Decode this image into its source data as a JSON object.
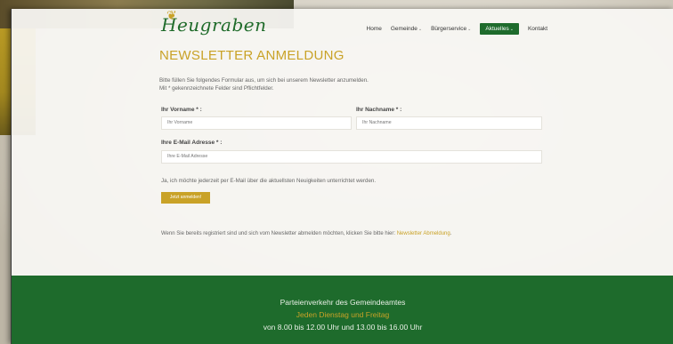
{
  "header": {
    "logo_text": "Heugraben",
    "nav": [
      {
        "label": "Home",
        "has_dropdown": false,
        "active": false
      },
      {
        "label": "Gemeinde",
        "has_dropdown": true,
        "active": false
      },
      {
        "label": "Bürgerservice",
        "has_dropdown": true,
        "active": false
      },
      {
        "label": "Aktuelles",
        "has_dropdown": true,
        "active": true
      },
      {
        "label": "Kontakt",
        "has_dropdown": false,
        "active": false
      }
    ],
    "dropdown_glyph": "⌄"
  },
  "main": {
    "title": "NEWSLETTER ANMELDUNG",
    "intro_line_1": "Bitte füllen Sie folgendes Formular aus, um sich bei unserem Newsletter anzumelden.",
    "intro_line_2": "Mit * gekennzeichnete Felder sind Pflichtfelder.",
    "form": {
      "firstname_label": "Ihr Vorname * :",
      "firstname_placeholder": "Ihr Vorname",
      "firstname_value": "",
      "lastname_label": "Ihr Nachname * :",
      "lastname_placeholder": "Ihr Nachname",
      "lastname_value": "",
      "email_label": "Ihre E-Mail Adresse * :",
      "email_placeholder": "Ihre E-Mail Adresse",
      "email_value": "",
      "consent_text": "Ja, ich möchte jederzeit per E-Mail über die aktuellsten Neuigkeiten unterrichtet werden.",
      "submit_label": "Jetzt anmelden!"
    },
    "unsubscribe_text": "Wenn Sie bereits registriert sind und sich vom Newsletter abmelden möchten, klicken Sie bitte hier:",
    "unsubscribe_link": "Newsletter Abmeldung"
  },
  "footer": {
    "line_1": "Parteienverkehr des Gemeindeamtes",
    "line_2": "Jeden Dienstag und Freitag",
    "line_3": "von 8.00 bis 12.00 Uhr und 13.00 bis 16.00 Uhr"
  },
  "colors": {
    "brand_green": "#1e6b2c",
    "accent_gold": "#c9a227"
  }
}
